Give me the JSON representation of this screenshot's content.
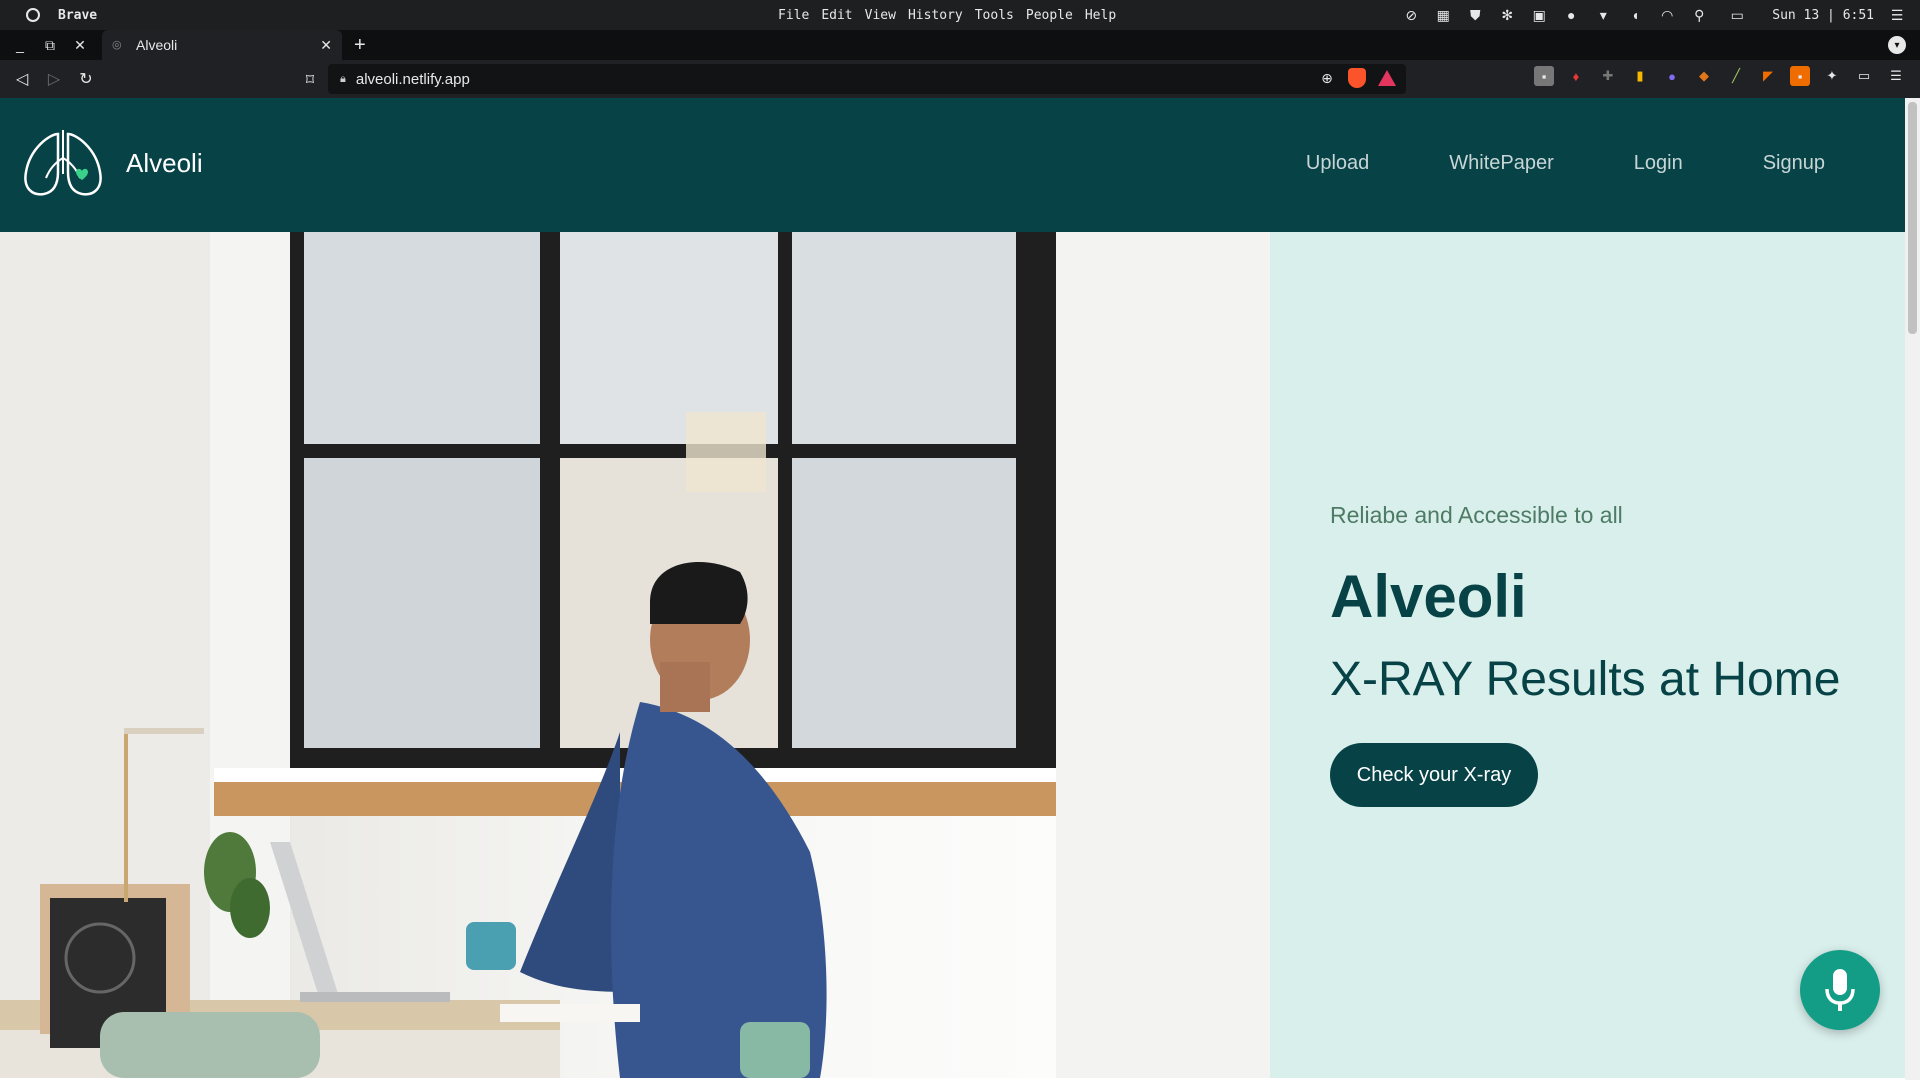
{
  "os": {
    "app_name": "Brave",
    "menu": [
      "File",
      "Edit",
      "View",
      "History",
      "Tools",
      "People",
      "Help"
    ],
    "clock": "Sun 13 | 6:51",
    "tray_icons": [
      "blocked-icon",
      "windows-icon",
      "shield-icon",
      "slack-icon",
      "terminal-icon",
      "microphone-icon",
      "dropdown-icon",
      "volume-icon",
      "wifi-icon",
      "search-icon",
      "battery-icon",
      "menu-icon"
    ]
  },
  "browser": {
    "tab_title": "Alveoli",
    "url": "alveoli.netlify.app",
    "extensions": [
      "ext-1",
      "ext-2",
      "ext-3",
      "ext-4",
      "ext-5",
      "ext-6",
      "ext-7",
      "ext-8",
      "ext-9",
      "puzzle-icon",
      "wallet-icon",
      "menu-icon"
    ]
  },
  "site": {
    "brand": "Alveoli",
    "nav": [
      "Upload",
      "WhitePaper",
      "Login",
      "Signup"
    ],
    "hero": {
      "tagline": "Reliabe and Accessible to all",
      "title": "Alveoli",
      "subtitle": "X-RAY Results at Home",
      "cta_label": "Check your X-ray"
    }
  },
  "colors": {
    "header_bg": "#074246",
    "hero_side_bg": "#d9efeb",
    "tagline": "#4e7b66",
    "mic_fab": "#139d87"
  }
}
